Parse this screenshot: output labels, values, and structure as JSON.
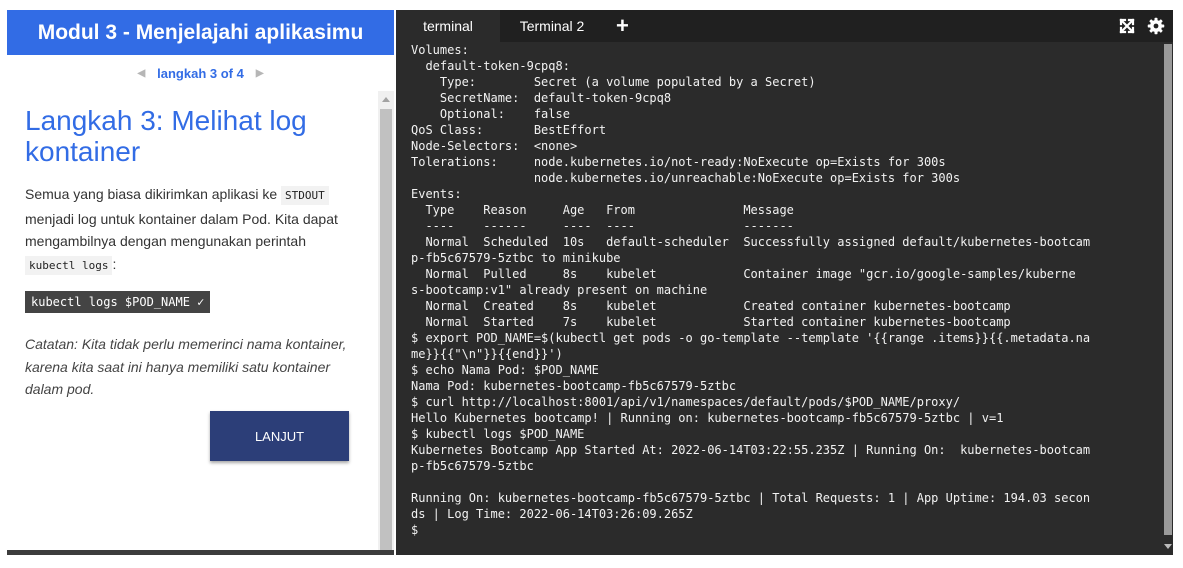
{
  "tutorial": {
    "module_title": "Modul 3 - Menjelajahi aplikasimu",
    "step_indicator": "langkah 3 of 4",
    "step_title": "Langkah 3: Melihat log kontainer",
    "paragraph_part1": "Semua yang biasa dikirimkan aplikasi ke ",
    "paragraph_code1": "STDOUT",
    "paragraph_part2": " menjadi log untuk kontainer dalam Pod. Kita dapat mengambilnya dengan mengunakan perintah ",
    "paragraph_code2": "kubectl logs",
    "paragraph_part3": ":",
    "command": "kubectl logs $POD_NAME ✓",
    "note": "Catatan: Kita tidak perlu memerinci nama kontainer, karena kita saat ini hanya memiliki satu kontainer dalam pod.",
    "next_label": "LANJUT"
  },
  "terminal": {
    "tabs": [
      {
        "label": "terminal",
        "active": true
      },
      {
        "label": "Terminal 2",
        "active": false
      }
    ],
    "add_tab_label": "+",
    "icons": [
      "fullscreen-icon",
      "gear-icon"
    ],
    "lines": [
      "Volumes:",
      "  default-token-9cpq8:",
      "    Type:        Secret (a volume populated by a Secret)",
      "    SecretName:  default-token-9cpq8",
      "    Optional:    false",
      "QoS Class:       BestEffort",
      "Node-Selectors:  <none>",
      "Tolerations:     node.kubernetes.io/not-ready:NoExecute op=Exists for 300s",
      "                 node.kubernetes.io/unreachable:NoExecute op=Exists for 300s",
      "Events:",
      "  Type    Reason     Age   From               Message",
      "  ----    ------     ----  ----               -------",
      "  Normal  Scheduled  10s   default-scheduler  Successfully assigned default/kubernetes-bootcam",
      "p-fb5c67579-5ztbc to minikube",
      "  Normal  Pulled     8s    kubelet            Container image \"gcr.io/google-samples/kuberne",
      "s-bootcamp:v1\" already present on machine",
      "  Normal  Created    8s    kubelet            Created container kubernetes-bootcamp",
      "  Normal  Started    7s    kubelet            Started container kubernetes-bootcamp",
      "$ export POD_NAME=$(kubectl get pods -o go-template --template '{{range .items}}{{.metadata.na",
      "me}}{{\"\\n\"}}{{end}}')",
      "$ echo Nama Pod: $POD_NAME",
      "Nama Pod: kubernetes-bootcamp-fb5c67579-5ztbc",
      "$ curl http://localhost:8001/api/v1/namespaces/default/pods/$POD_NAME/proxy/",
      "Hello Kubernetes bootcamp! | Running on: kubernetes-bootcamp-fb5c67579-5ztbc | v=1",
      "$ kubectl logs $POD_NAME",
      "Kubernetes Bootcamp App Started At: 2022-06-14T03:22:55.235Z | Running On:  kubernetes-bootcam",
      "p-fb5c67579-5ztbc",
      "",
      "Running On: kubernetes-bootcamp-fb5c67579-5ztbc | Total Requests: 1 | App Uptime: 194.03 secon",
      "ds | Log Time: 2022-06-14T03:26:09.265Z",
      "$"
    ]
  },
  "colors": {
    "brand_blue": "#326ce5",
    "button_navy": "#2c3e78",
    "terminal_bg": "#2b2b2b",
    "tab_bar_bg": "#202020"
  }
}
